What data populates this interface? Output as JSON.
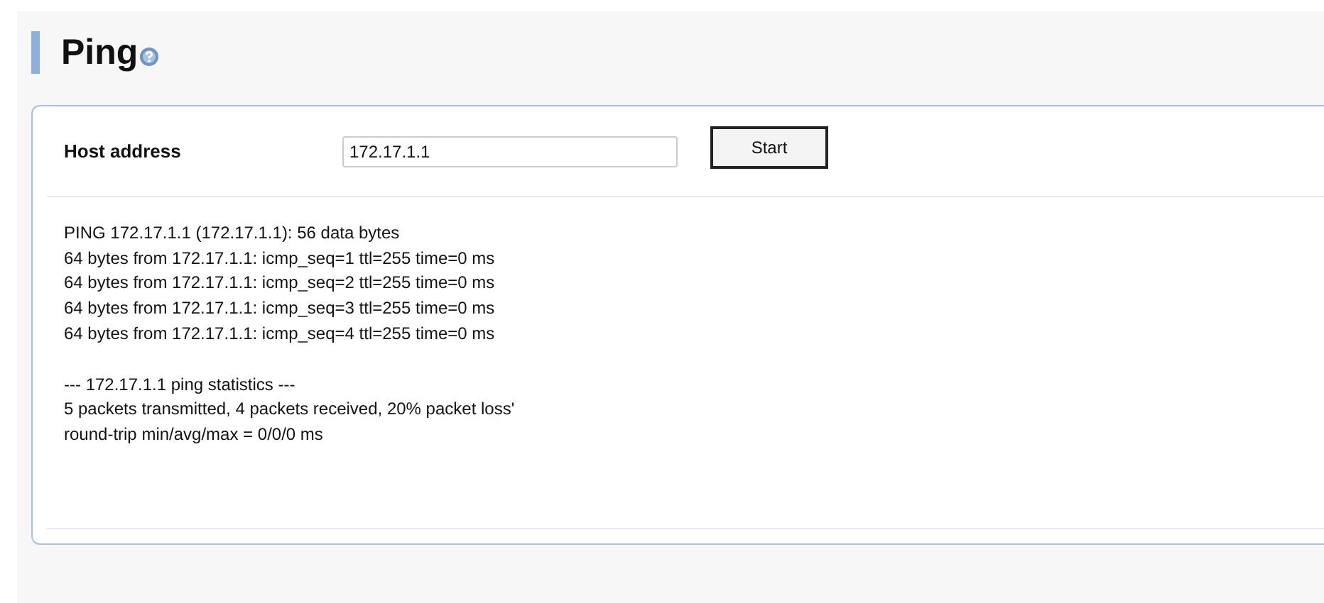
{
  "page": {
    "title": "Ping"
  },
  "host": {
    "label": "Host address",
    "value": "172.17.1.1",
    "button": "Start"
  },
  "output": {
    "reply_lines": [
      "PING 172.17.1.1 (172.17.1.1): 56 data bytes",
      "64 bytes from 172.17.1.1: icmp_seq=1 ttl=255 time=0 ms",
      "64 bytes from 172.17.1.1: icmp_seq=2 ttl=255 time=0 ms",
      "64 bytes from 172.17.1.1: icmp_seq=3 ttl=255 time=0 ms",
      "64 bytes from 172.17.1.1: icmp_seq=4 ttl=255 time=0 ms"
    ],
    "statistics_lines": [
      "--- 172.17.1.1 ping statistics ---",
      "5 packets transmitted, 4 packets received, 20% packet loss'",
      "round-trip min/avg/max = 0/0/0 ms"
    ]
  }
}
